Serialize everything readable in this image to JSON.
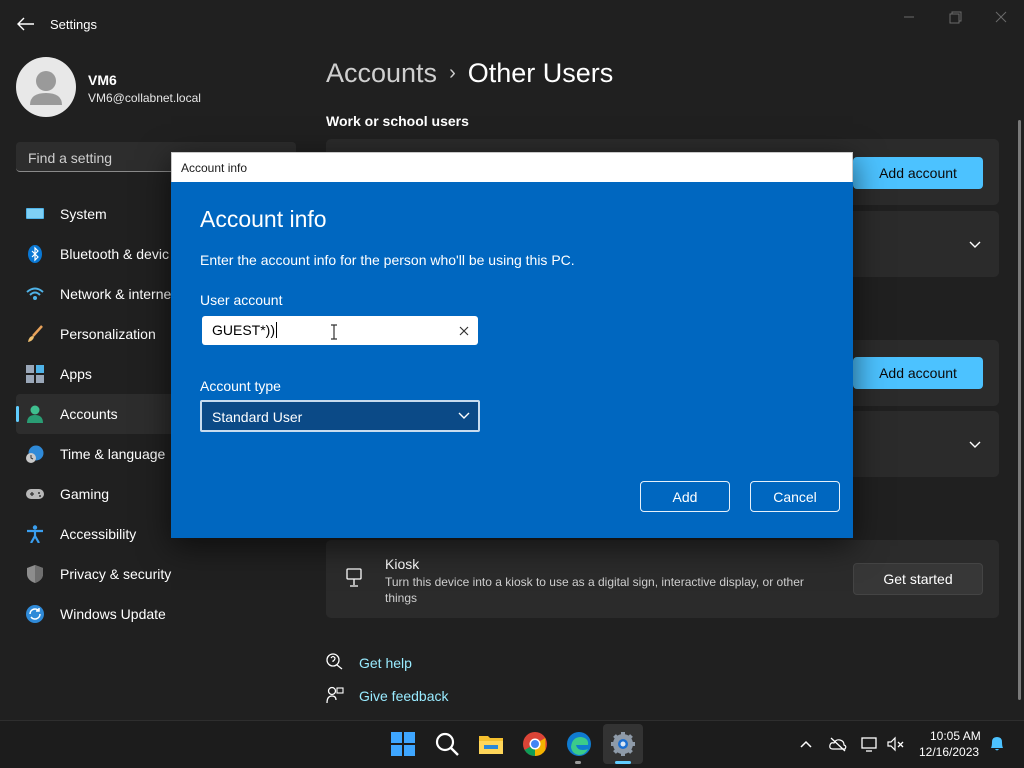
{
  "window": {
    "title": "Settings",
    "back_icon": "arrow-left-icon",
    "controls": [
      "minimize-icon",
      "maximize-icon",
      "close-icon"
    ]
  },
  "user": {
    "name": "VM6",
    "email": "VM6@collabnet.local"
  },
  "search": {
    "placeholder": "Find a setting"
  },
  "sidebar": {
    "items": [
      {
        "label": "System",
        "icon": "monitor-icon"
      },
      {
        "label": "Bluetooth & devic",
        "icon": "bluetooth-icon"
      },
      {
        "label": "Network & interne",
        "icon": "wifi-icon"
      },
      {
        "label": "Personalization",
        "icon": "brush-icon"
      },
      {
        "label": "Apps",
        "icon": "apps-icon"
      },
      {
        "label": "Accounts",
        "icon": "person-icon",
        "selected": true
      },
      {
        "label": "Time & language",
        "icon": "globe-clock-icon"
      },
      {
        "label": "Gaming",
        "icon": "gamepad-icon"
      },
      {
        "label": "Accessibility",
        "icon": "accessibility-icon"
      },
      {
        "label": "Privacy & security",
        "icon": "shield-icon"
      },
      {
        "label": "Windows Update",
        "icon": "update-icon"
      }
    ]
  },
  "main": {
    "breadcrumb_parent": "Accounts",
    "breadcrumb_current": "Other Users",
    "work_section_title": "Work or school users",
    "add_account_label_1": "Add account",
    "add_account_label_2": "Add account",
    "kiosk": {
      "title": "Kiosk",
      "description": "Turn this device into a kiosk to use as a digital sign, interactive display, or other things",
      "button": "Get started",
      "icon": "kiosk-icon"
    },
    "get_help": "Get help",
    "give_feedback": "Give feedback"
  },
  "dialog": {
    "titlebar": "Account info",
    "heading": "Account info",
    "description": "Enter the account info for the person who'll be using this PC.",
    "user_account_label": "User account",
    "user_account_value": "GUEST*))",
    "account_type_label": "Account type",
    "account_type_value": "Standard User",
    "add_button": "Add",
    "cancel_button": "Cancel"
  },
  "taskbar": {
    "apps": [
      "windows-start-icon",
      "search-icon",
      "file-explorer-icon",
      "chrome-icon",
      "edge-icon",
      "settings-icon"
    ],
    "tray": [
      "chevron-up-icon",
      "cloud-off-icon",
      "screen-icon",
      "volume-muted-icon",
      "notification-bell-icon"
    ],
    "time": "10:05 AM",
    "date": "12/16/2023"
  },
  "colors": {
    "background": "#202020",
    "accent": "#4cc2ff",
    "dialog_blue": "#0067c0",
    "card": "#2b2b2b"
  }
}
